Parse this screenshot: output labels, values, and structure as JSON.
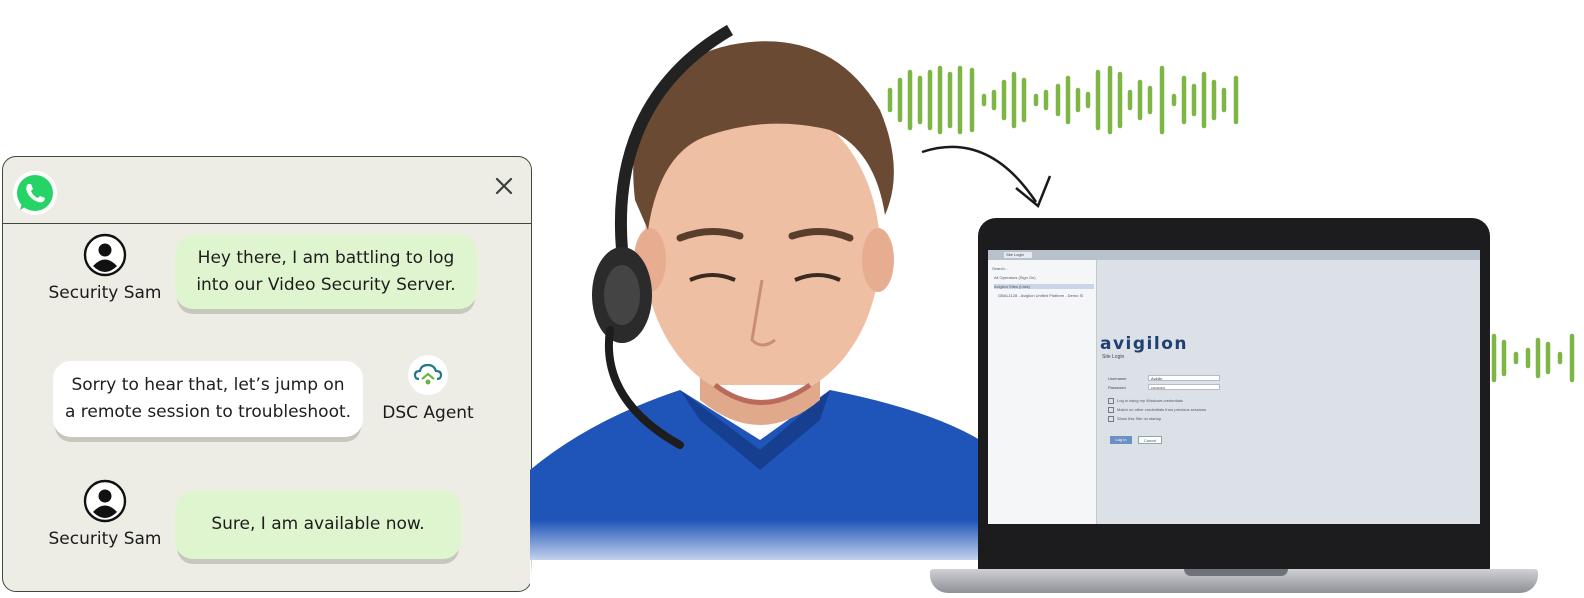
{
  "chat": {
    "app_icon": "whatsapp-icon",
    "close_icon": "close-icon",
    "messages": [
      {
        "sender": "Security Sam",
        "text_line1": "Hey there, I am battling to log",
        "text_line2": "into our Video Security Server."
      },
      {
        "sender": "DSC Agent",
        "text_line1": "Sorry to hear that, let’s jump on",
        "text_line2": "a remote session to troubleshoot."
      },
      {
        "sender": "Security Sam",
        "text_line1": "Sure, I am available now."
      }
    ]
  },
  "laptop_screen": {
    "tab_label": "Site Login",
    "sidebar_search": "Search...",
    "sidebar_items": [
      "All Operators (Sign On)",
      "Avigilon Sites (Lists)",
      "GBAL1128 - Avigilon Unified Platform - Demo Si"
    ],
    "brand": "avigilon",
    "subtitle": "Site Login",
    "username_label": "Username",
    "username_value": "Avidlo",
    "password_label": "Password",
    "password_value": "••••••••••",
    "options": [
      "Log in using my Windows credentials",
      "Match on other credentials from previous sessions",
      "Show this Site on startup"
    ],
    "login_button": "Log in",
    "cancel_button": "Cancel"
  },
  "colors": {
    "chat_bg": "#edede6",
    "green_bubble": "#dff5cf",
    "wave_green": "#7db645",
    "whatsapp_green": "#25d366"
  }
}
